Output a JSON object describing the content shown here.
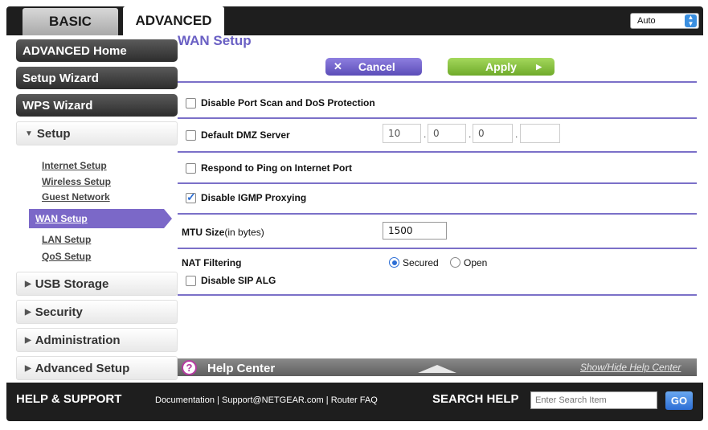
{
  "tabs": {
    "basic": "BASIC",
    "advanced": "ADVANCED"
  },
  "language": {
    "selected": "Auto"
  },
  "sidebar": {
    "advanced_home": "ADVANCED Home",
    "setup_wizard": "Setup Wizard",
    "wps_wizard": "WPS Wizard",
    "setup": "Setup",
    "setup_items": {
      "internet": "Internet Setup",
      "wireless": "Wireless Setup",
      "guest": "Guest Network",
      "wan": "WAN Setup",
      "lan": "LAN Setup",
      "qos": "QoS Setup"
    },
    "usb_storage": "USB Storage",
    "security": "Security",
    "administration": "Administration",
    "advanced_setup": "Advanced Setup"
  },
  "main": {
    "title": "WAN Setup",
    "cancel_label": "Cancel",
    "apply_label": "Apply",
    "disable_port_scan": "Disable Port Scan and DoS Protection",
    "default_dmz": "Default DMZ Server",
    "dmz_ip": [
      "10",
      "0",
      "0",
      ""
    ],
    "respond_ping": "Respond to Ping on Internet Port",
    "disable_igmp": "Disable IGMP Proxying",
    "mtu_label": "MTU Size",
    "mtu_unit": "(in bytes)",
    "mtu_value": "1500",
    "nat_label": "NAT Filtering",
    "nat_secured": "Secured",
    "nat_open": "Open",
    "disable_sip": "Disable SIP ALG"
  },
  "help": {
    "title": "Help Center",
    "show_hide": "Show/Hide Help Center"
  },
  "footer": {
    "help_support": "HELP & SUPPORT",
    "documentation": "Documentation",
    "sep": " | ",
    "support_email": "Support@NETGEAR.com",
    "router_faq": "Router FAQ",
    "search_label": "SEARCH HELP",
    "search_placeholder": "Enter Search Item",
    "go": "GO"
  },
  "colors": {
    "accent": "#7b68c8",
    "apply": "#7fbf3a",
    "frame": "#1e1e1e"
  }
}
